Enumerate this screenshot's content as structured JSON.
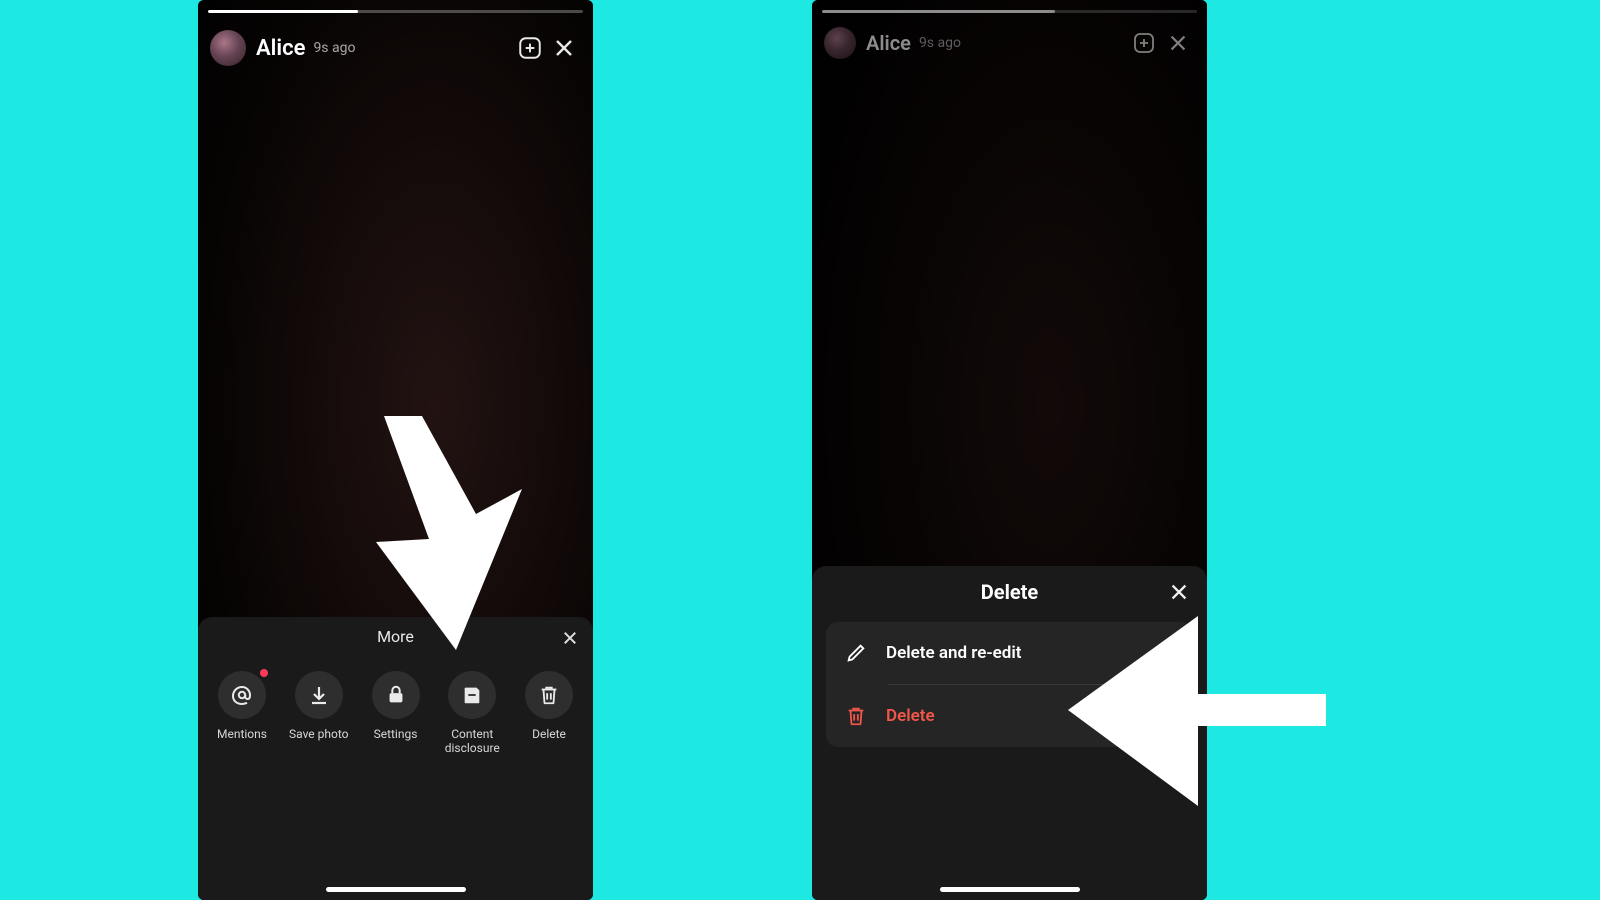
{
  "left": {
    "username": "Alice",
    "timestamp": "9s ago",
    "sheet": {
      "title": "More",
      "items": [
        {
          "label": "Mentions",
          "icon": "at-icon",
          "badge": true
        },
        {
          "label": "Save photo",
          "icon": "download-icon",
          "badge": false
        },
        {
          "label": "Settings",
          "icon": "lock-icon",
          "badge": false
        },
        {
          "label": "Content disclosure",
          "icon": "content-disclosure-icon",
          "badge": false
        },
        {
          "label": "Delete",
          "icon": "trash-icon",
          "badge": false
        }
      ]
    }
  },
  "right": {
    "username": "Alice",
    "timestamp": "9s ago",
    "sheet": {
      "title": "Delete",
      "options": [
        {
          "label": "Delete and re-edit",
          "icon": "edit-icon",
          "danger": false
        },
        {
          "label": "Delete",
          "icon": "trash-icon",
          "danger": true
        }
      ]
    }
  },
  "colors": {
    "danger": "#f1564a",
    "bg": "#1de9e2"
  }
}
